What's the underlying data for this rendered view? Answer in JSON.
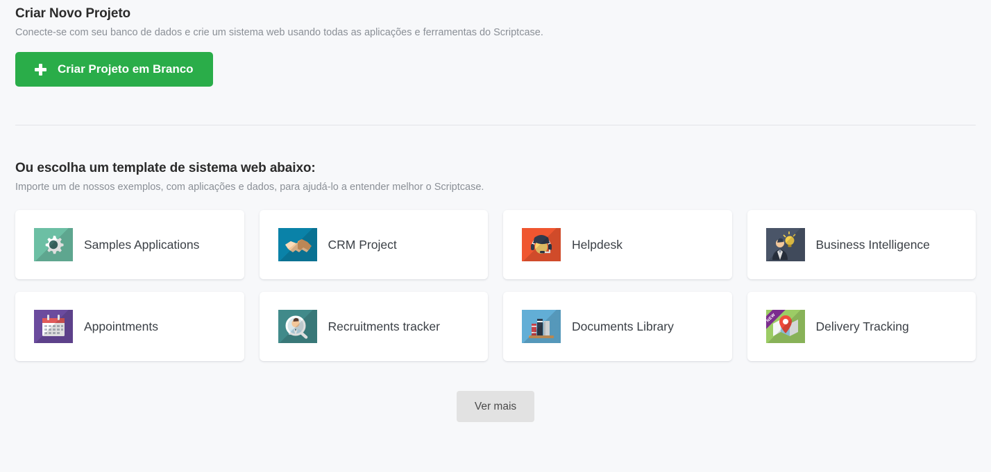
{
  "create_section": {
    "title": "Criar Novo Projeto",
    "subtitle": "Conecte-se com seu banco de dados e crie um sistema web usando todas as aplicações e ferramentas do Scriptcase.",
    "button_label": "Criar Projeto em Branco",
    "button_color": "#2aad49"
  },
  "templates_section": {
    "title": "Ou escolha um template de sistema web abaixo:",
    "subtitle": "Importe um de nossos exemplos, com aplicações e dados, para ajudá-lo a entender melhor o Scriptcase.",
    "cards": [
      {
        "label": "Samples Applications",
        "icon": "gear-icon",
        "bg": "#6cbfa4",
        "badge": ""
      },
      {
        "label": "CRM Project",
        "icon": "handshake-icon",
        "bg": "#0a82a8",
        "badge": ""
      },
      {
        "label": "Helpdesk",
        "icon": "headset-agent-icon",
        "bg": "#ef5630",
        "badge": ""
      },
      {
        "label": "Business Intelligence",
        "icon": "businessman-lightbulb-icon",
        "bg": "#4a5568",
        "badge": ""
      },
      {
        "label": "Appointments",
        "icon": "calendar-icon",
        "bg": "#6b4b9e",
        "badge": ""
      },
      {
        "label": "Recruitments tracker",
        "icon": "person-search-icon",
        "bg": "#418a8a",
        "badge": ""
      },
      {
        "label": "Documents Library",
        "icon": "books-icon",
        "bg": "#62aed6",
        "badge": ""
      },
      {
        "label": "Delivery Tracking",
        "icon": "map-pin-icon",
        "bg": "#9ccc65",
        "badge": "NEW"
      }
    ]
  },
  "footer": {
    "more_label": "Ver mais"
  }
}
